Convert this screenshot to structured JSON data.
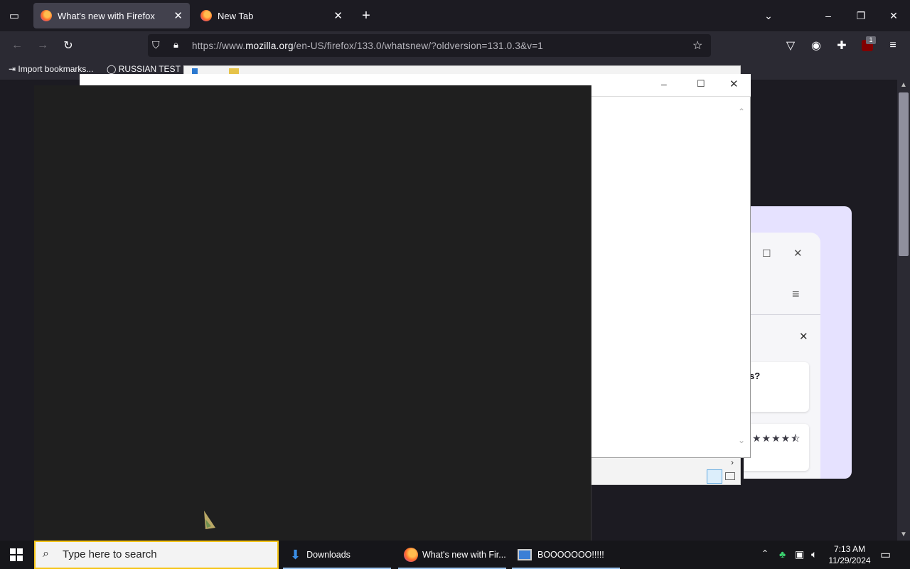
{
  "browser": {
    "tabs": [
      {
        "label": "What's new with Firefox",
        "active": true
      },
      {
        "label": "New Tab",
        "active": false
      }
    ],
    "url": {
      "prefix": "https://www.",
      "domain": "mozilla.org",
      "path": "/en-US/firefox/133.0/whatsnew/?oldversion=131.0.3&v=1"
    },
    "bookmarks": [
      {
        "label": "Import bookmarks..."
      },
      {
        "label": "RUSSIAN TEST"
      }
    ],
    "extension_badge": "1",
    "colors": {
      "frame": "#1c1b22",
      "toolbar": "#2b2a33",
      "active_tab": "#42414d"
    }
  },
  "page": {
    "question_fragment": "s?",
    "rating_stars": 4.5
  },
  "windows": {
    "black_window": {
      "bg": "#1f1f1f"
    },
    "taskbar_apps": [
      {
        "label": "Downloads",
        "icon": "download-arrow-icon"
      },
      {
        "label": "What's new with Fir...",
        "icon": "firefox-icon"
      },
      {
        "label": "BOOOOOOO!!!!!",
        "icon": "app-window-icon"
      }
    ]
  },
  "taskbar": {
    "search_placeholder": "Type here to search",
    "time": "7:13 AM",
    "date": "11/29/2024"
  }
}
